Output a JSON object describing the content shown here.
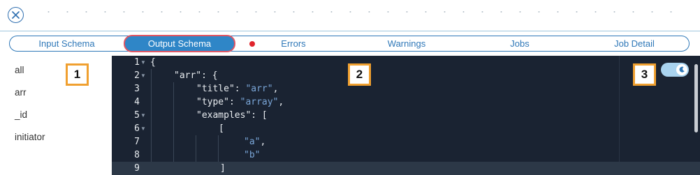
{
  "tabs": [
    {
      "label": "Input Schema",
      "active": false
    },
    {
      "label": "Output Schema",
      "active": true
    },
    {
      "label": "Errors",
      "active": false,
      "has_error_indicator": true
    },
    {
      "label": "Warnings",
      "active": false
    },
    {
      "label": "Jobs",
      "active": false
    },
    {
      "label": "Job Detail",
      "active": false
    }
  ],
  "sidebar": {
    "fields": [
      "all",
      "arr",
      "_id",
      "initiator"
    ]
  },
  "editor": {
    "lines": [
      {
        "num": "1",
        "text": "{"
      },
      {
        "num": "2",
        "text": "\"arr\": {"
      },
      {
        "num": "3",
        "key": "\"title\": ",
        "value": "\"arr\"",
        "suffix": ","
      },
      {
        "num": "4",
        "key": "\"type\": ",
        "value": "\"array\"",
        "suffix": ","
      },
      {
        "num": "5",
        "text": "\"examples\": ["
      },
      {
        "num": "6",
        "text": "["
      },
      {
        "num": "7",
        "value": "\"a\"",
        "suffix": ","
      },
      {
        "num": "8",
        "value": "\"b\""
      },
      {
        "num": "9",
        "text": "]"
      }
    ],
    "theme_toggle": "dark-mode-moon-icon"
  },
  "callouts": [
    "1",
    "2",
    "3"
  ],
  "colors": {
    "accent": "#2f78b8",
    "active_tab_bg": "#2f86c7",
    "active_tab_border": "#e05563",
    "error_dot": "#e0242c",
    "editor_bg": "#1a2332",
    "string_value": "#7aa6d8",
    "callout_border": "#f0a030"
  }
}
